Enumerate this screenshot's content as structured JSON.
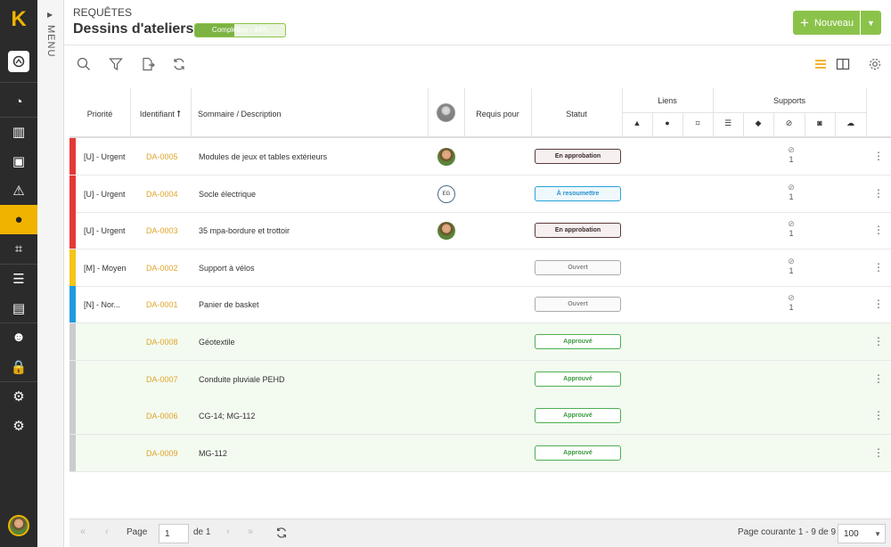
{
  "app": {
    "logo": "K"
  },
  "rail": {
    "items": [
      {
        "icon": "dashboard-icon",
        "glyph": "◔"
      },
      {
        "icon": "library-icon",
        "glyph": "▥"
      },
      {
        "icon": "images-icon",
        "glyph": "▣"
      },
      {
        "icon": "warning-icon",
        "glyph": "⚠"
      },
      {
        "icon": "map-pin-icon",
        "glyph": "●"
      },
      {
        "icon": "scan-icon",
        "glyph": "⌗"
      },
      {
        "icon": "list-icon",
        "glyph": "☰"
      },
      {
        "icon": "document-icon",
        "glyph": "▤"
      },
      {
        "icon": "team-icon",
        "glyph": "☻"
      },
      {
        "icon": "lock-icon",
        "glyph": "🔒"
      },
      {
        "icon": "settings-icon",
        "glyph": "⚙"
      },
      {
        "icon": "admin-settings-icon",
        "glyph": "⚙"
      }
    ]
  },
  "menu": {
    "label": "MENU"
  },
  "header": {
    "kicker": "REQUÊTES",
    "title": "Dessins d'ateliers",
    "progress_label": "Complétion : 44%",
    "progress": 0.44,
    "new_label": "Nouveau"
  },
  "columns": {
    "priority": "Priorité",
    "id": "Identifiant",
    "desc": "Sommaire / Description",
    "required": "Requis pour",
    "status": "Statut",
    "links": "Liens",
    "supports": "Supports"
  },
  "rows": [
    {
      "priority": "[U] - Urgent",
      "color": "#e53935",
      "id": "DA-0005",
      "desc": "Modules de jeux et tables extérieurs",
      "avatar": "photo",
      "status": "En approbation",
      "stype": "appr",
      "att": "1"
    },
    {
      "priority": "[U] - Urgent",
      "color": "#e53935",
      "id": "DA-0004",
      "desc": "Socle électrique",
      "avatar": "EG",
      "status": "À resoumettre",
      "stype": "res",
      "att": "1"
    },
    {
      "priority": "[U] - Urgent",
      "color": "#e53935",
      "id": "DA-0003",
      "desc": "35 mpa-bordure et trottoir",
      "avatar": "photo",
      "status": "En approbation",
      "stype": "appr",
      "att": "1"
    },
    {
      "priority": "[M] - Moyen",
      "color": "#f5c518",
      "id": "DA-0002",
      "desc": "Support à vélos",
      "avatar": "",
      "status": "Ouvert",
      "stype": "open",
      "att": "1"
    },
    {
      "priority": "[N] - Nor...",
      "color": "#1e9be0",
      "id": "DA-0001",
      "desc": "Panier de basket",
      "avatar": "",
      "status": "Ouvert",
      "stype": "open",
      "att": "1"
    },
    {
      "priority": "",
      "color": "#cccccc",
      "id": "DA-0008",
      "desc": "Géotextile",
      "avatar": "",
      "status": "Approuvé",
      "stype": "ok",
      "att": ""
    },
    {
      "priority": "",
      "color": "#cccccc",
      "id": "DA-0007",
      "desc": "Conduite pluviale PEHD",
      "avatar": "",
      "status": "Approuvé",
      "stype": "ok",
      "att": ""
    },
    {
      "priority": "",
      "color": "#cccccc",
      "id": "DA-0006",
      "desc": "CG-14; MG-112",
      "avatar": "",
      "status": "Approuvé",
      "stype": "ok",
      "att": ""
    },
    {
      "priority": "",
      "color": "#cccccc",
      "id": "DA-0009",
      "desc": "MG-112",
      "avatar": "",
      "status": "Approuvé",
      "stype": "ok",
      "att": ""
    }
  ],
  "footer": {
    "page_label": "Page",
    "page_value": "1",
    "of_label": "de 1",
    "summary": "Page courante 1 - 9 de 9",
    "per_page": "100"
  }
}
